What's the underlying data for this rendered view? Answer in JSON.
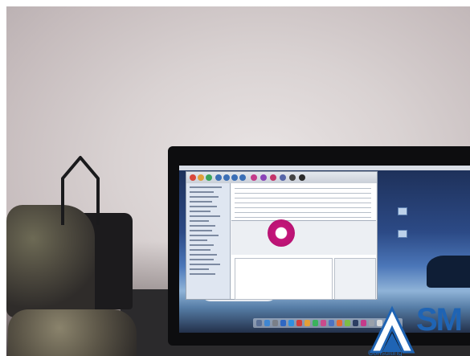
{
  "scene": {
    "description_label": "",
    "logo": {
      "text": "SM",
      "subtitle": "Consulting"
    }
  },
  "colors": {
    "logo_blue": "#1f64b4",
    "target_magenta": "#c4157a",
    "desktop_blue": "#2c4a86"
  },
  "icons": [
    "coat-hook-icon",
    "target-circle-icon",
    "dock-icon",
    "folder-icon"
  ]
}
